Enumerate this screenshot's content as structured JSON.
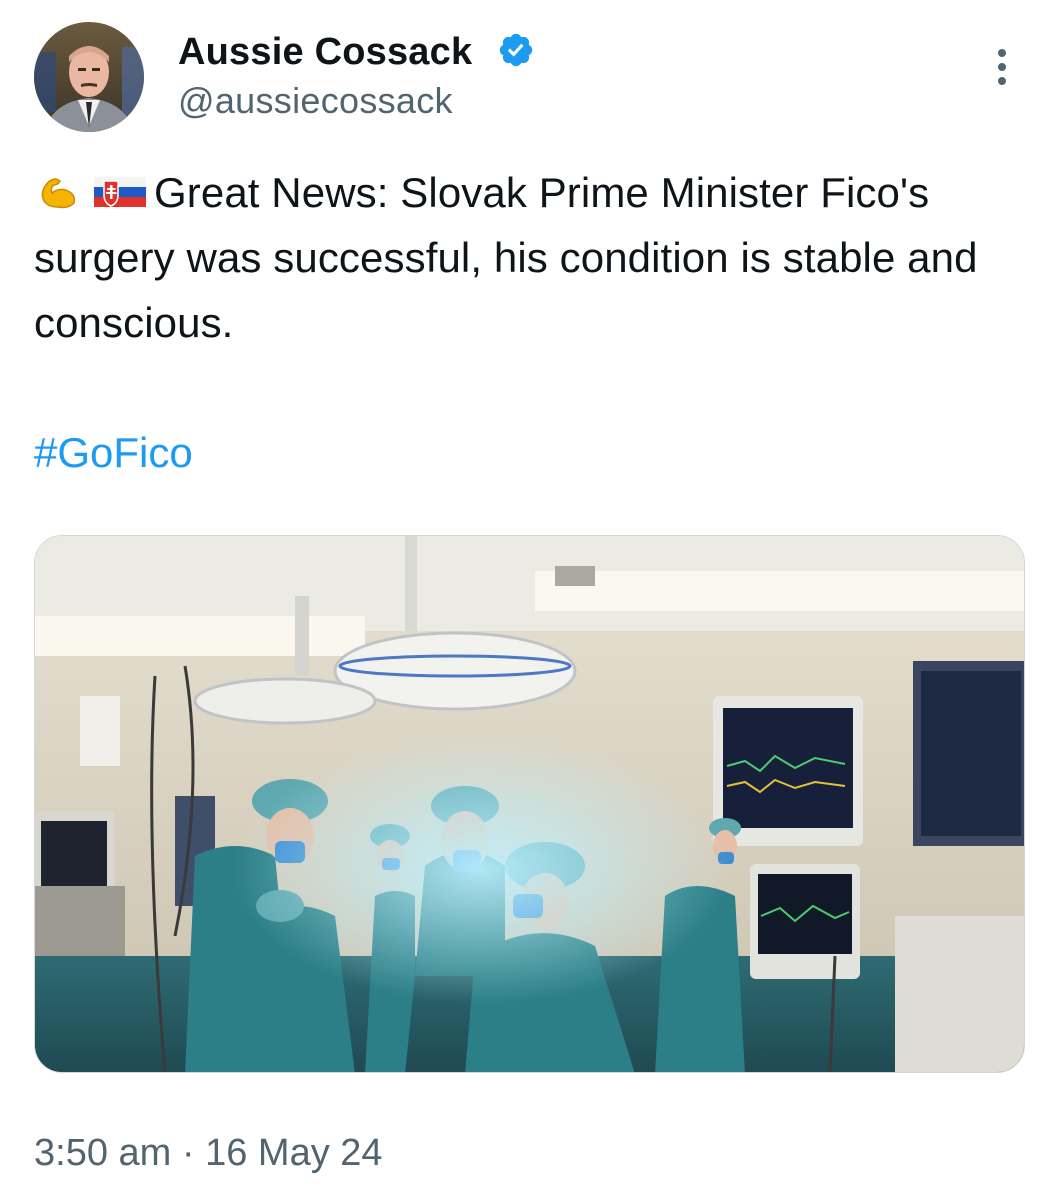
{
  "author": {
    "display_name": "Aussie Cossack",
    "handle": "@aussiecossack",
    "verified": true,
    "avatar_icon": "profile-photo"
  },
  "tweet": {
    "emoji": [
      "flexed-biceps-emoji",
      "slovakia-flag-emoji"
    ],
    "text": "Great News: Slovak Prime Minister Fico's surgery was successful, his condition is stable and conscious.",
    "hashtag": "#GoFico",
    "media_description_icon": "operating-room-photo"
  },
  "meta": {
    "time": "3:50 am",
    "separator": "·",
    "date": "16 May 24"
  },
  "colors": {
    "text": "#0f1419",
    "secondary": "#536471",
    "link": "#1d9bf0",
    "verified": "#1d9bf0"
  }
}
